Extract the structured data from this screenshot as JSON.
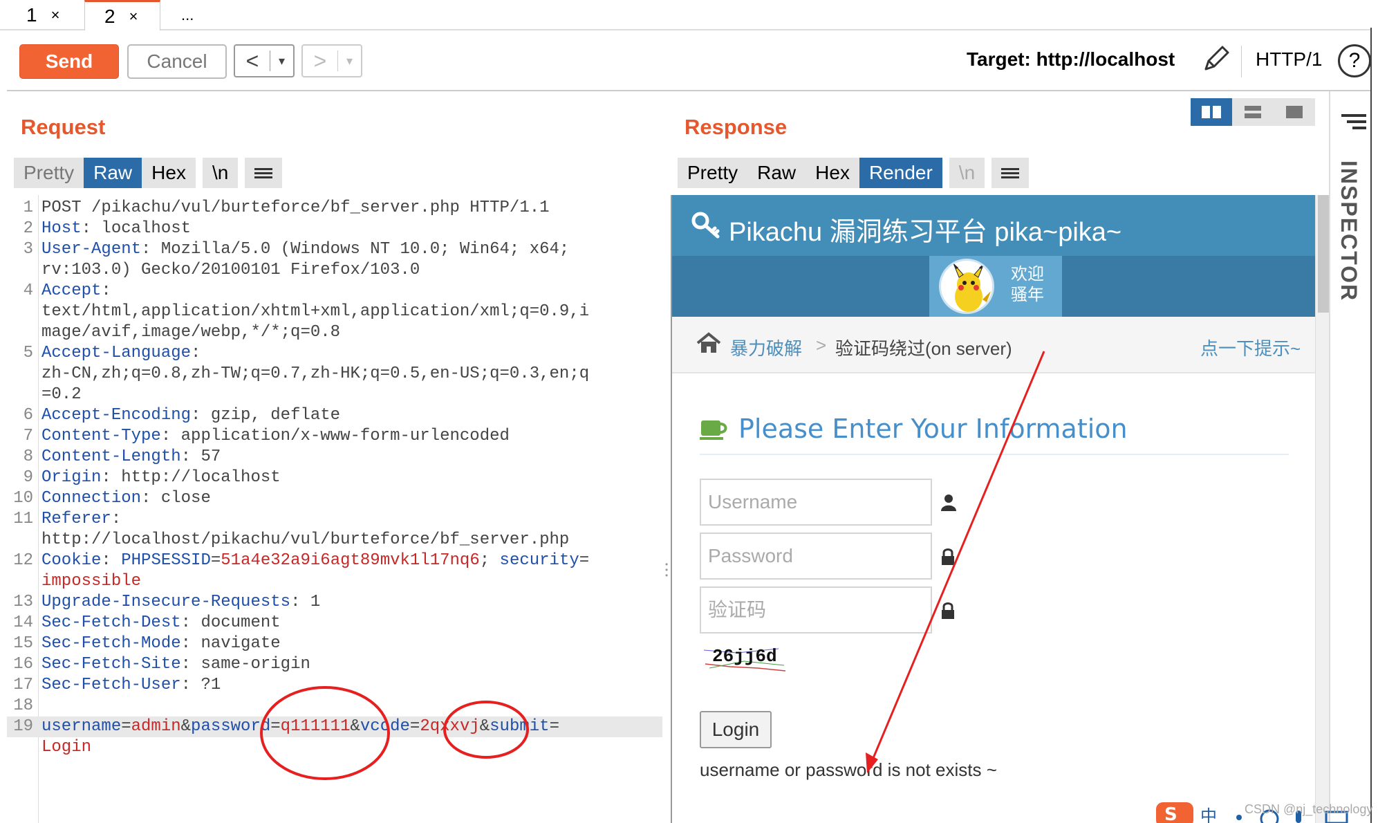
{
  "tabs": [
    {
      "label": "1",
      "close": "×"
    },
    {
      "label": "2",
      "close": "×"
    },
    {
      "label": "..."
    }
  ],
  "toolbar": {
    "send": "Send",
    "cancel": "Cancel",
    "back": "<",
    "forward": ">",
    "dropdown": "▾",
    "target": "Target: http://localhost",
    "http_version": "HTTP/1",
    "help": "?"
  },
  "request": {
    "title": "Request",
    "views": [
      "Pretty",
      "Raw",
      "Hex",
      "\\n"
    ],
    "active_view": "Raw",
    "lines": [
      {
        "n": "1",
        "parts": [
          {
            "t": "POST /pikachu/vul/burteforce/bf_server.php HTTP/1.1",
            "c": "hv"
          }
        ]
      },
      {
        "n": "2",
        "parts": [
          {
            "t": "Host",
            "c": "hk"
          },
          {
            "t": ": localhost",
            "c": "hv"
          }
        ]
      },
      {
        "n": "3",
        "parts": [
          {
            "t": "User-Agent",
            "c": "hk"
          },
          {
            "t": ": Mozilla/5.0 (Windows NT 10.0; Win64; x64;",
            "c": "hv"
          }
        ]
      },
      {
        "n": "",
        "parts": [
          {
            "t": "rv:103.0) Gecko/20100101 Firefox/103.0",
            "c": "hv"
          }
        ]
      },
      {
        "n": "4",
        "parts": [
          {
            "t": "Accept",
            "c": "hk"
          },
          {
            "t": ":",
            "c": "hv"
          }
        ]
      },
      {
        "n": "",
        "parts": [
          {
            "t": "text/html,application/xhtml+xml,application/xml;q=0.9,i",
            "c": "hv"
          }
        ]
      },
      {
        "n": "",
        "parts": [
          {
            "t": "mage/avif,image/webp,*/*;q=0.8",
            "c": "hv"
          }
        ]
      },
      {
        "n": "5",
        "parts": [
          {
            "t": "Accept-Language",
            "c": "hk"
          },
          {
            "t": ":",
            "c": "hv"
          }
        ]
      },
      {
        "n": "",
        "parts": [
          {
            "t": "zh-CN,zh;q=0.8,zh-TW;q=0.7,zh-HK;q=0.5,en-US;q=0.3,en;q",
            "c": "hv"
          }
        ]
      },
      {
        "n": "",
        "parts": [
          {
            "t": "=0.2",
            "c": "hv"
          }
        ]
      },
      {
        "n": "6",
        "parts": [
          {
            "t": "Accept-Encoding",
            "c": "hk"
          },
          {
            "t": ": gzip, deflate",
            "c": "hv"
          }
        ]
      },
      {
        "n": "7",
        "parts": [
          {
            "t": "Content-Type",
            "c": "hk"
          },
          {
            "t": ": application/x-www-form-urlencoded",
            "c": "hv"
          }
        ]
      },
      {
        "n": "8",
        "parts": [
          {
            "t": "Content-Length",
            "c": "hk"
          },
          {
            "t": ": 57",
            "c": "hv"
          }
        ]
      },
      {
        "n": "9",
        "parts": [
          {
            "t": "Origin",
            "c": "hk"
          },
          {
            "t": ": http://localhost",
            "c": "hv"
          }
        ]
      },
      {
        "n": "10",
        "parts": [
          {
            "t": "Connection",
            "c": "hk"
          },
          {
            "t": ": close",
            "c": "hv"
          }
        ]
      },
      {
        "n": "11",
        "parts": [
          {
            "t": "Referer",
            "c": "hk"
          },
          {
            "t": ":",
            "c": "hv"
          }
        ]
      },
      {
        "n": "",
        "parts": [
          {
            "t": "http://localhost/pikachu/vul/burteforce/bf_server.php",
            "c": "hv"
          }
        ]
      },
      {
        "n": "12",
        "parts": [
          {
            "t": "Cookie",
            "c": "hk"
          },
          {
            "t": ": ",
            "c": "hv"
          },
          {
            "t": "PHPSESSID",
            "c": "hk"
          },
          {
            "t": "=",
            "c": "hv"
          },
          {
            "t": "51a4e32a9i6agt89mvk1l17nq6",
            "c": "pv"
          },
          {
            "t": "; ",
            "c": "hv"
          },
          {
            "t": "security",
            "c": "hk"
          },
          {
            "t": "=",
            "c": "hv"
          }
        ]
      },
      {
        "n": "",
        "parts": [
          {
            "t": "impossible",
            "c": "pv"
          }
        ]
      },
      {
        "n": "13",
        "parts": [
          {
            "t": "Upgrade-Insecure-Requests",
            "c": "hk"
          },
          {
            "t": ": 1",
            "c": "hv"
          }
        ]
      },
      {
        "n": "14",
        "parts": [
          {
            "t": "Sec-Fetch-Dest",
            "c": "hk"
          },
          {
            "t": ": document",
            "c": "hv"
          }
        ]
      },
      {
        "n": "15",
        "parts": [
          {
            "t": "Sec-Fetch-Mode",
            "c": "hk"
          },
          {
            "t": ": navigate",
            "c": "hv"
          }
        ]
      },
      {
        "n": "16",
        "parts": [
          {
            "t": "Sec-Fetch-Site",
            "c": "hk"
          },
          {
            "t": ": same-origin",
            "c": "hv"
          }
        ]
      },
      {
        "n": "17",
        "parts": [
          {
            "t": "Sec-Fetch-User",
            "c": "hk"
          },
          {
            "t": ": ?1",
            "c": "hv"
          }
        ]
      },
      {
        "n": "18",
        "parts": []
      },
      {
        "n": "19",
        "hl": true,
        "parts": [
          {
            "t": "username",
            "c": "hk"
          },
          {
            "t": "=",
            "c": "hv"
          },
          {
            "t": "admin",
            "c": "pv"
          },
          {
            "t": "&",
            "c": "hv"
          },
          {
            "t": "password",
            "c": "hk"
          },
          {
            "t": "=",
            "c": "hv"
          },
          {
            "t": "q111111",
            "c": "pv"
          },
          {
            "t": "&",
            "c": "hv"
          },
          {
            "t": "vcode",
            "c": "hk"
          },
          {
            "t": "=",
            "c": "hv"
          },
          {
            "t": "2qxxvj",
            "c": "pv"
          },
          {
            "t": "&",
            "c": "hv"
          },
          {
            "t": "submit",
            "c": "hk"
          },
          {
            "t": "=",
            "c": "hv"
          }
        ]
      },
      {
        "n": "",
        "parts": [
          {
            "t": "Login",
            "c": "pv"
          }
        ]
      }
    ]
  },
  "response": {
    "title": "Response",
    "views": [
      "Pretty",
      "Raw",
      "Hex",
      "Render",
      "\\n"
    ],
    "active_view": "Render",
    "page": {
      "site_title": "Pikachu 漏洞练习平台 pika~pika~",
      "welcome_line1": "欢迎",
      "welcome_line2": "骚年",
      "breadcrumb_home": "暴力破解",
      "breadcrumb_sep": ">",
      "breadcrumb_current": "验证码绕过(on server)",
      "hint_link": "点一下提示~",
      "form_title": "Please Enter Your Information",
      "username_placeholder": "Username",
      "password_placeholder": "Password",
      "vcode_placeholder": "验证码",
      "captcha_text": "26jj6d",
      "login_button": "Login",
      "message": "username or password is not exists ~"
    }
  },
  "inspector": {
    "label": "INSPECTOR"
  },
  "watermark": "CSDN @nj_technology",
  "colors": {
    "accent": "#f26334",
    "active_tab": "#2a6ba8",
    "header_blue": "#438eb9",
    "annotation_red": "#e62020"
  }
}
